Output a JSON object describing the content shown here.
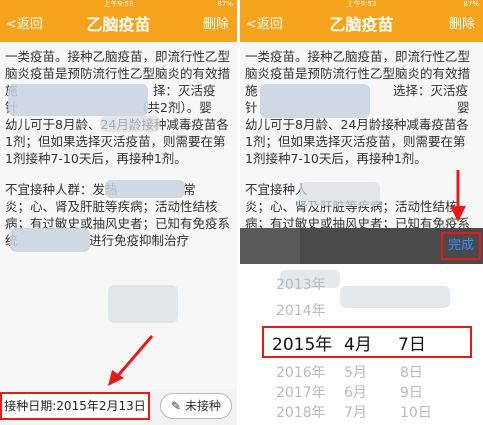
{
  "status": {
    "time": "上午9:53",
    "battery": "87%"
  },
  "nav": {
    "back_label": "<返回",
    "title": "乙脑疫苗",
    "delete_label": "删除"
  },
  "left": {
    "content_lines": [
      "一类疫苗。接种乙脑疫苗，即流行性乙型",
      "脑炎疫苗是预防流行性乙型脑炎的有效措",
      "施",
      "针",
      "幼儿可于8月龄、24月龄接种减毒疫苗各",
      "1剂；但如果选择灭活疫苗，则需要在第",
      "1剂接种7-10天后，再接种1剂。"
    ],
    "contra_lines": [
      "不宜接种人群：发热",
      "炎；心、肾及肝脏等疾病；活动性结核",
      "病；有过敏史或抽风史者；已知有免疫系",
      "统",
      "进行免疫抑制治疗"
    ],
    "left_fragments": {
      "choice": "择：灭活疫",
      "doses": "（共2剂）。婴",
      "ying": "婴",
      "chang": "常",
      "shenyan": "、肾"
    },
    "date_button": "接种日期:2015年2月13日",
    "skip_button": "未接种",
    "skip_icon": "pencil-icon"
  },
  "right": {
    "content_lines": [
      "一类疫苗。接种乙脑疫苗，即流行性乙型",
      "脑炎疫苗是预防流行性乙型脑炎的有效措",
      "施",
      "针",
      "幼儿可于8月龄、24月龄接种减毒疫苗各",
      "1剂；但如果选择灭活疫苗，则需要在第",
      "1剂接种7-10天后，再接种1剂。"
    ],
    "right_fragments": {
      "choice": "选择：灭活疫",
      "ying": "婴"
    },
    "contra_lines": [
      "不宜接种人",
      "炎；心、肾及肝脏等疾病；活动性结核",
      "病；有过敏史或抽风史者；已知有免疫系"
    ],
    "done_button": "完成",
    "picker_rows": [
      {
        "year": "2013年",
        "month": "",
        "day": ""
      },
      {
        "year": "2014年",
        "month": "",
        "day": ""
      },
      {
        "year": "2015年",
        "month": "4月",
        "day": "7日"
      },
      {
        "year": "2016年",
        "month": "5月",
        "day": "8日"
      },
      {
        "year": "2017年",
        "month": "6月",
        "day": "9日"
      },
      {
        "year": "2018年",
        "month": "7月",
        "day": "10日"
      }
    ]
  },
  "colors": {
    "accent": "#f5a21c",
    "highlight": "#e31b1b",
    "link": "#3b8cff"
  }
}
